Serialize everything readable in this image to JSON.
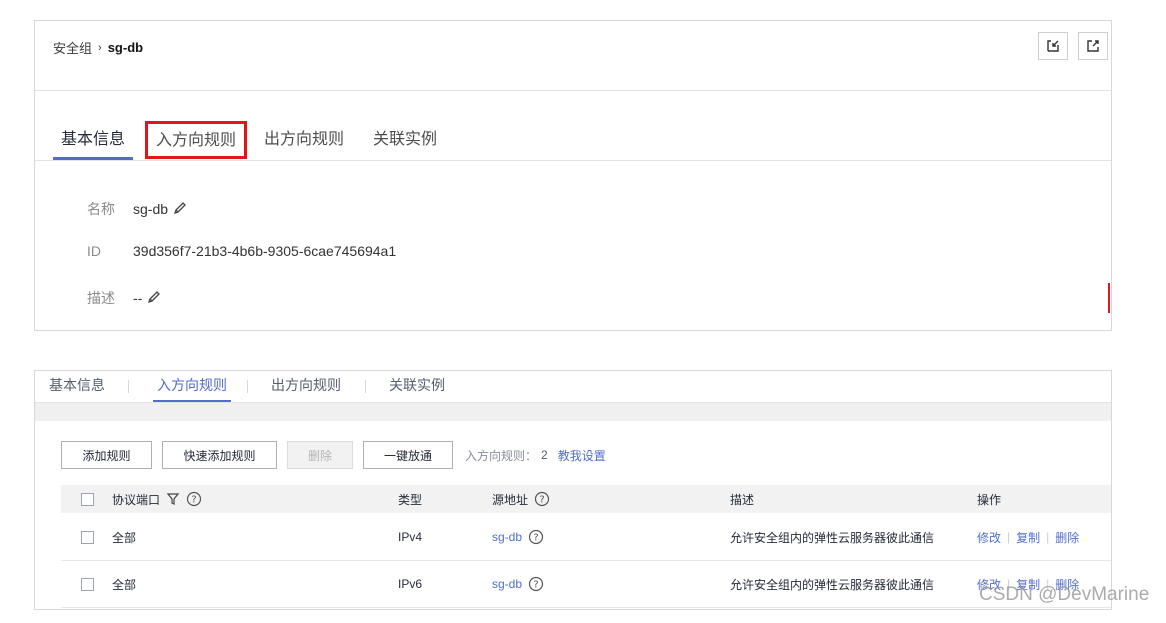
{
  "panel1": {
    "breadcrumb": {
      "parent": "安全组",
      "current": "sg-db"
    },
    "tabs": [
      "基本信息",
      "入方向规则",
      "出方向规则",
      "关联实例"
    ],
    "info": [
      {
        "label": "名称",
        "value": "sg-db",
        "editable": true
      },
      {
        "label": "ID",
        "value": "39d356f7-21b3-4b6b-9305-6cae745694a1",
        "editable": false
      },
      {
        "label": "描述",
        "value": "--",
        "editable": true
      }
    ],
    "highlight_color": "#e0161c"
  },
  "panel2": {
    "tabs": [
      "基本信息",
      "入方向规则",
      "出方向规则",
      "关联实例"
    ],
    "toolbar": {
      "add_rule": "添加规则",
      "quick_add": "快速添加规则",
      "delete": "删除",
      "allow_all": "一键放通",
      "rule_count_label": "入方向规则：",
      "rule_count": "2",
      "help_link": "教我设置"
    },
    "table": {
      "headers": {
        "protocol": "协议端口",
        "type": "类型",
        "source": "源地址",
        "description": "描述",
        "actions": "操作"
      },
      "rows": [
        {
          "protocol": "全部",
          "type": "IPv4",
          "source": "sg-db",
          "description": "允许安全组内的弹性云服务器彼此通信",
          "actions": [
            "修改",
            "复制",
            "删除"
          ]
        },
        {
          "protocol": "全部",
          "type": "IPv6",
          "source": "sg-db",
          "description": "允许安全组内的弹性云服务器彼此通信",
          "actions": [
            "修改",
            "复制",
            "删除"
          ]
        }
      ]
    },
    "accent_color": "#526ecc"
  },
  "watermark": "CSDN @DevMarine"
}
